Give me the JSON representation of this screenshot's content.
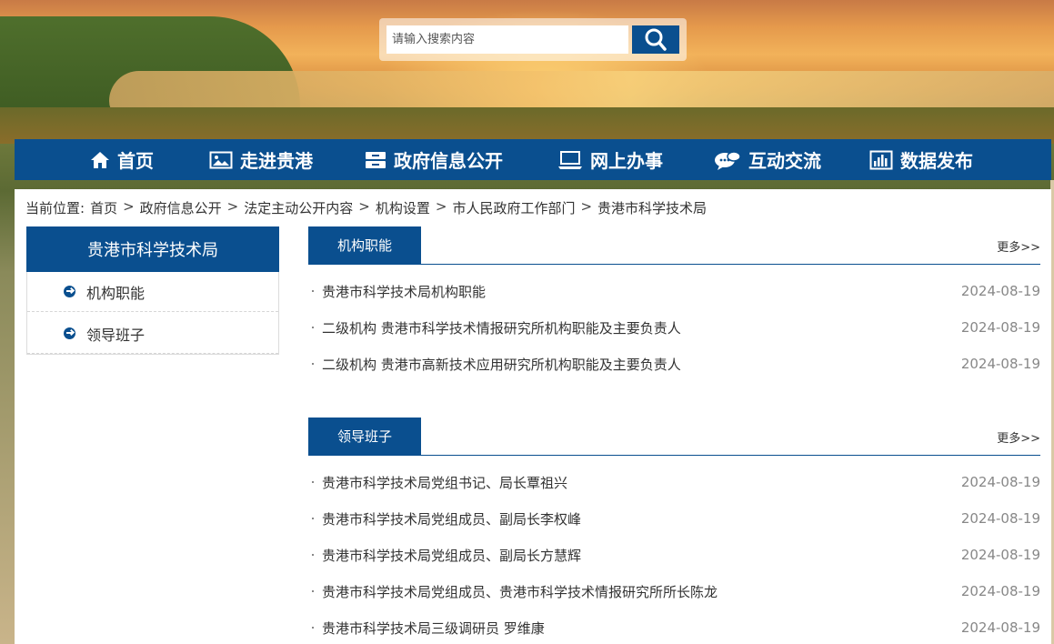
{
  "search": {
    "placeholder": "请输入搜索内容",
    "icon": "search-icon"
  },
  "nav": {
    "items": [
      {
        "label": "首页",
        "icon": "home-icon"
      },
      {
        "label": "走进贵港",
        "icon": "picture-icon"
      },
      {
        "label": "政府信息公开",
        "icon": "cabinet-icon"
      },
      {
        "label": "网上办事",
        "icon": "laptop-icon"
      },
      {
        "label": "互动交流",
        "icon": "chat-icon"
      },
      {
        "label": "数据发布",
        "icon": "bar-chart-icon"
      }
    ]
  },
  "breadcrumb": {
    "prefix": "当前位置:",
    "items": [
      "首页",
      "政府信息公开",
      "法定主动公开内容",
      "机构设置",
      "市人民政府工作部门",
      "贵港市科学技术局"
    ],
    "separator": ">"
  },
  "sidebar": {
    "title": "贵港市科学技术局",
    "items": [
      {
        "label": "机构职能"
      },
      {
        "label": "领导班子"
      }
    ]
  },
  "sections": [
    {
      "title": "机构职能",
      "more": "更多>>",
      "items": [
        {
          "title": "贵港市科学技术局机构职能",
          "date": "2024-08-19"
        },
        {
          "title": "二级机构 贵港市科学技术情报研究所机构职能及主要负责人",
          "date": "2024-08-19"
        },
        {
          "title": "二级机构 贵港市高新技术应用研究所机构职能及主要负责人",
          "date": "2024-08-19"
        }
      ]
    },
    {
      "title": "领导班子",
      "more": "更多>>",
      "items": [
        {
          "title": "贵港市科学技术局党组书记、局长覃祖兴",
          "date": "2024-08-19"
        },
        {
          "title": "贵港市科学技术局党组成员、副局长李权峰",
          "date": "2024-08-19"
        },
        {
          "title": "贵港市科学技术局党组成员、副局长方慧辉",
          "date": "2024-08-19"
        },
        {
          "title": "贵港市科学技术局党组成员、贵港市科学技术情报研究所所长陈龙",
          "date": "2024-08-19"
        },
        {
          "title": "贵港市科学技术局三级调研员 罗维康",
          "date": "2024-08-19"
        }
      ]
    }
  ],
  "colors": {
    "primary": "#0a4f8f",
    "text": "#333333",
    "date": "#888888"
  }
}
